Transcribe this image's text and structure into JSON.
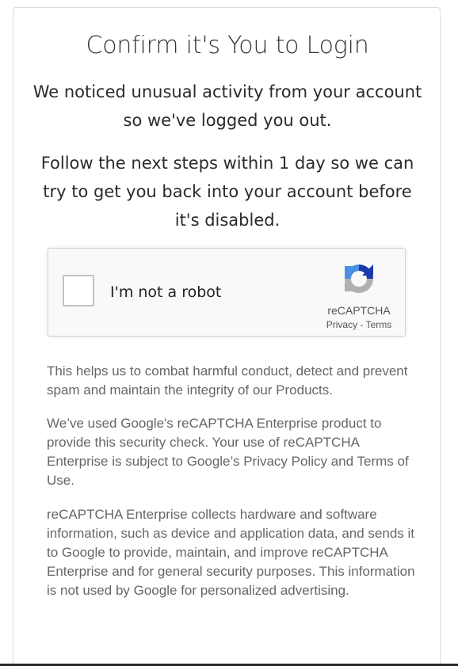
{
  "page": {
    "title": "Confirm it's You to Login",
    "notice": "We noticed unusual activity from your account so we've logged you out.",
    "instructions": "Follow the next steps within 1 day so we can try to get you back into your account before it's disabled."
  },
  "recaptcha": {
    "checkbox_label": "I'm not a robot",
    "brand": "reCAPTCHA",
    "privacy_link": "Privacy",
    "separator": " - ",
    "terms_link": "Terms",
    "logo_icon": "recaptcha-logo-icon",
    "colors": {
      "logo_blue": "#1c3aa9",
      "logo_light_blue": "#4a90e2",
      "logo_gray": "#b0b0b0"
    }
  },
  "info": {
    "paragraph_1": "This helps us to combat harmful conduct, detect and prevent spam and maintain the integrity of our Products.",
    "paragraph_2": "We’ve used Google's reCAPTCHA Enterprise product to provide this security check. Your use of reCAPTCHA Enterprise is subject to Google’s Privacy Policy and Terms of Use.",
    "paragraph_3": "reCAPTCHA Enterprise collects hardware and software information, such as device and application data, and sends it to Google to provide, maintain, and improve reCAPTCHA Enterprise and for general security purposes. This information is not used by Google for personalized advertising."
  }
}
